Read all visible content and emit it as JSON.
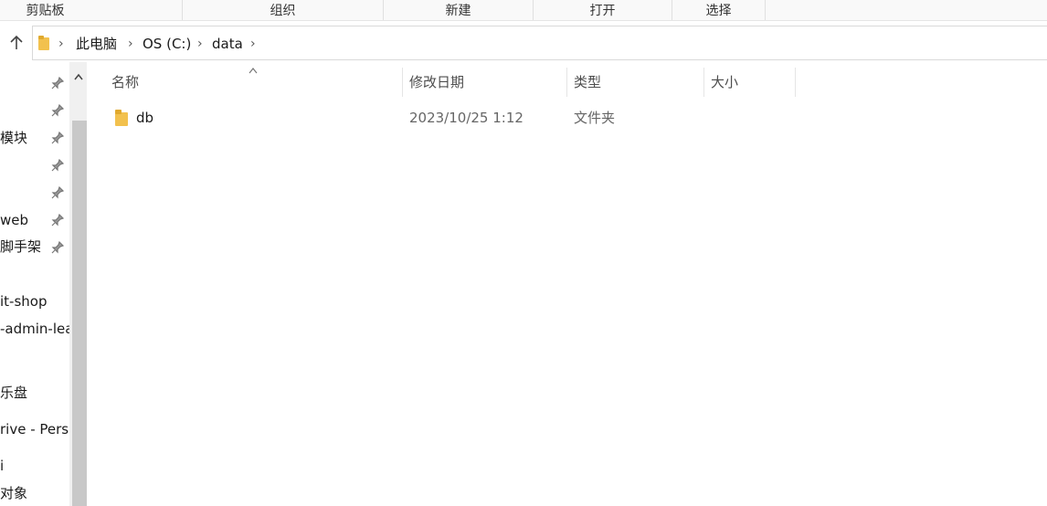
{
  "ribbon": {
    "groups": [
      "剪贴板",
      "组织",
      "新建",
      "打开",
      "选择"
    ]
  },
  "address": {
    "segments": [
      "此电脑",
      "OS (C:)",
      "data"
    ]
  },
  "sidebar": {
    "items": [
      "模块",
      "web",
      "脚手架",
      "it-shop",
      "-admin-lea",
      "乐盘",
      "rive - Perso",
      "i",
      "对象"
    ]
  },
  "columns": {
    "name": "名称",
    "modified": "修改日期",
    "type": "类型",
    "size": "大小"
  },
  "files": [
    {
      "name": "db",
      "modified": "2023/10/25 1:12",
      "type": "文件夹",
      "size": ""
    }
  ],
  "colors": {
    "folder": "#f2c14e",
    "accent": "#0067c0"
  },
  "icons": {
    "up": "up-arrow-icon",
    "chevron": "chevron-right-icon",
    "pin": "pin-icon",
    "folder": "folder-icon"
  }
}
